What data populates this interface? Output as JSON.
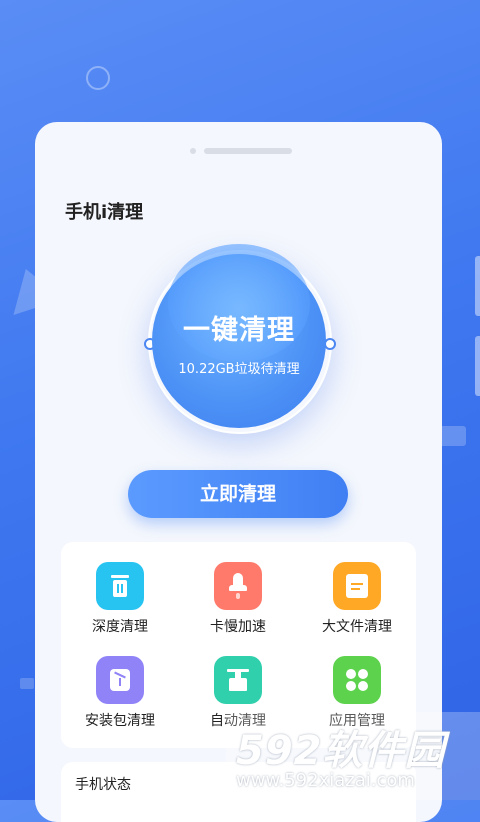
{
  "app": {
    "title": "手机i清理"
  },
  "orb": {
    "title": "一键清理",
    "subtitle": "10.22GB垃圾待清理"
  },
  "actions": {
    "clean_now": "立即清理"
  },
  "tools": [
    {
      "label": "深度清理",
      "icon": "trash-icon",
      "color": "#27c4f1"
    },
    {
      "label": "卡慢加速",
      "icon": "rocket-icon",
      "color": "#ff7a6b"
    },
    {
      "label": "大文件清理",
      "icon": "file-icon",
      "color": "#ffa825"
    },
    {
      "label": "安装包清理",
      "icon": "package-icon",
      "color": "#8f83f7"
    },
    {
      "label": "自动清理",
      "icon": "broom-icon",
      "color": "#30d0ad"
    },
    {
      "label": "应用管理",
      "icon": "apps-icon",
      "color": "#5dd24d"
    }
  ],
  "status": {
    "title": "手机状态"
  },
  "watermark": {
    "brand": "592软件园",
    "url": "www.592xiazai.com"
  },
  "colors": {
    "background": "#3f78f0",
    "card": "#f4f7fd",
    "accent": "#4d93f6"
  }
}
